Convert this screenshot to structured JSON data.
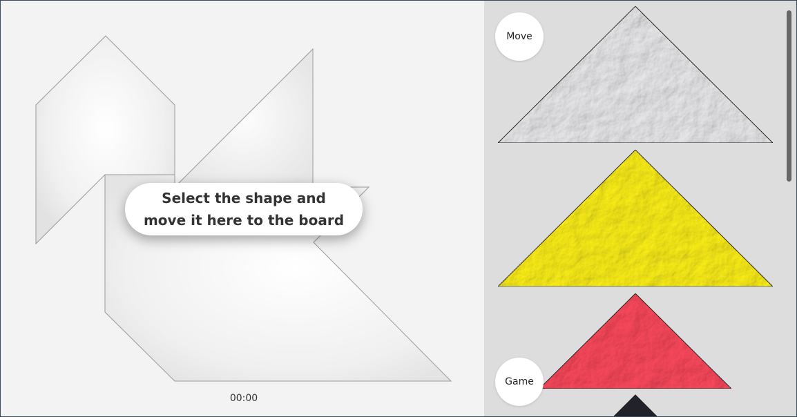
{
  "board": {
    "instruction": "Select the shape and move it here to the board",
    "timer": "00:00"
  },
  "tray": {
    "move_label": "Move",
    "game_label": "Game",
    "pieces": [
      {
        "name": "tray-piece-white-triangle",
        "color": "#ececee"
      },
      {
        "name": "tray-piece-yellow-triangle",
        "color": "#fff21a"
      },
      {
        "name": "tray-piece-red-triangle",
        "color": "#ff4a5e"
      },
      {
        "name": "tray-piece-dark-triangle",
        "color": "#22222a"
      }
    ]
  }
}
